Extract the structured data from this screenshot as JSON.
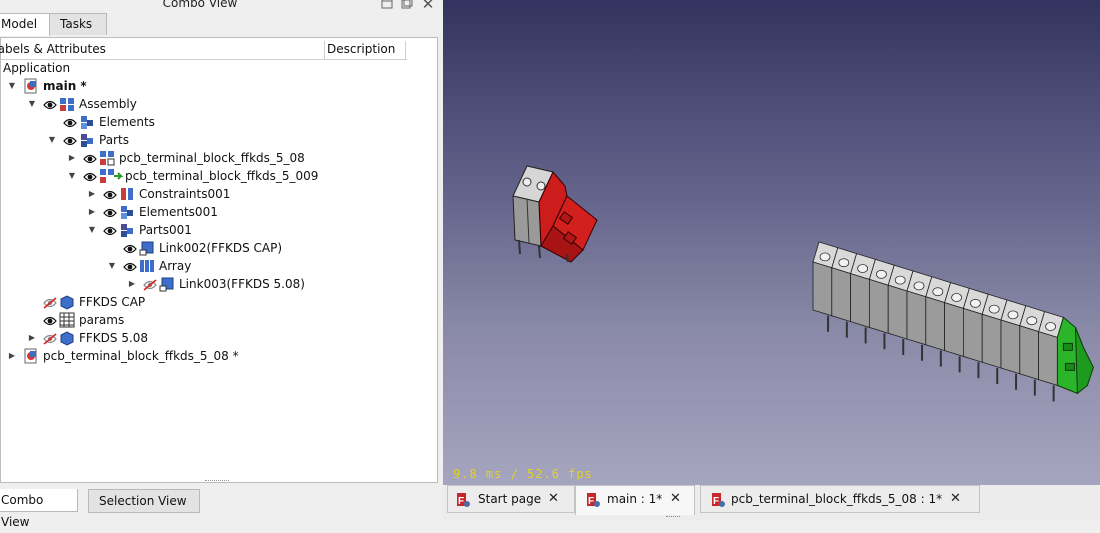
{
  "combo": {
    "title": "Combo View",
    "tabs": [
      "Model",
      "Tasks"
    ],
    "header": {
      "labels": "Labels & Attributes",
      "description": "Description"
    },
    "bottom_tabs": [
      "Combo View",
      "Selection View"
    ]
  },
  "tree": [
    {
      "label": "Application",
      "level": 0,
      "arrow": "",
      "eye": "none",
      "icon": ""
    },
    {
      "label": "main *",
      "level": 1,
      "arrow": "down",
      "eye": "none",
      "icon": "document-icon",
      "bold": true
    },
    {
      "label": "Assembly",
      "level": 2,
      "arrow": "down",
      "eye": "visible",
      "icon": "assembly-icon"
    },
    {
      "label": "Elements",
      "level": 3,
      "arrow": "",
      "eye": "visible",
      "icon": "elements-icon"
    },
    {
      "label": "Parts",
      "level": 3,
      "arrow": "down",
      "eye": "visible",
      "icon": "parts-icon"
    },
    {
      "label": "pcb_terminal_block_ffkds_5_08",
      "level": 4,
      "arrow": "right",
      "eye": "visible",
      "icon": "assembly-link-icon"
    },
    {
      "label": "pcb_terminal_block_ffkds_5_009",
      "level": 4,
      "arrow": "down",
      "eye": "visible",
      "icon": "assembly-link-green-icon"
    },
    {
      "label": "Constraints001",
      "level": 5,
      "arrow": "right",
      "eye": "visible",
      "icon": "constraints-icon"
    },
    {
      "label": "Elements001",
      "level": 5,
      "arrow": "right",
      "eye": "visible",
      "icon": "elements-icon"
    },
    {
      "label": "Parts001",
      "level": 5,
      "arrow": "down",
      "eye": "visible",
      "icon": "parts-icon"
    },
    {
      "label": "Link002(FFKDS CAP)",
      "level": 6,
      "arrow": "",
      "eye": "visible",
      "icon": "link-icon"
    },
    {
      "label": "Array",
      "level": 6,
      "arrow": "down",
      "eye": "visible",
      "icon": "array-icon"
    },
    {
      "label": "Link003(FFKDS 5.08)",
      "level": 7,
      "arrow": "right",
      "eye": "hidden",
      "icon": "link-icon"
    },
    {
      "label": "FFKDS CAP",
      "level": 2,
      "arrow": "",
      "eye": "hidden",
      "icon": "part-icon"
    },
    {
      "label": "params",
      "level": 2,
      "arrow": "",
      "eye": "visible",
      "icon": "spreadsheet-icon"
    },
    {
      "label": "FFKDS 5.08",
      "level": 2,
      "arrow": "right",
      "eye": "hidden",
      "icon": "part-icon"
    },
    {
      "label": "pcb_terminal_block_ffkds_5_08 *",
      "level": 1,
      "arrow": "right",
      "eye": "none",
      "icon": "document-icon"
    }
  ],
  "view3d": {
    "fps_text": "9.8 ms / 52.6 fps"
  },
  "doc_tabs": [
    {
      "label": "Start page",
      "active": false
    },
    {
      "label": "main : 1*",
      "active": true
    },
    {
      "label": "pcb_terminal_block_ffkds_5_08 : 1*",
      "active": false
    }
  ]
}
